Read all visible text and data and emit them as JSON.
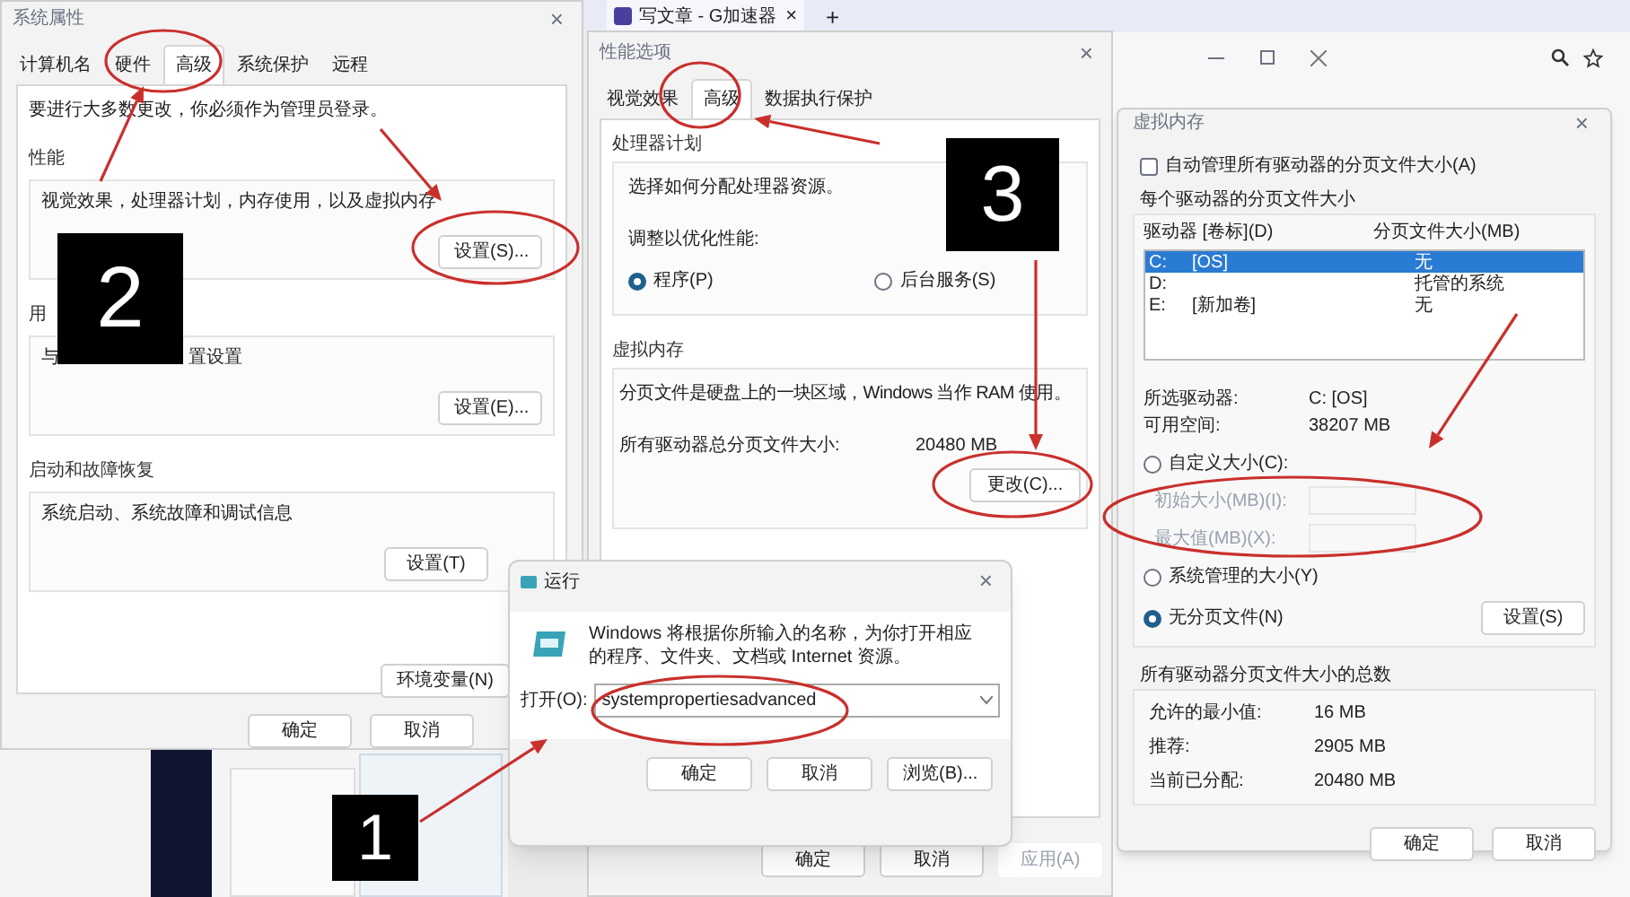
{
  "browser": {
    "tab": {
      "title": "写文章 - G加速器",
      "close": "×"
    },
    "new_tab": "+"
  },
  "system_properties": {
    "title": "系统属性",
    "close": "×",
    "tabs": [
      {
        "label": "计算机名",
        "selected": false
      },
      {
        "label": "硬件",
        "selected": false
      },
      {
        "label": "高级",
        "selected": true
      },
      {
        "label": "系统保护",
        "selected": false
      },
      {
        "label": "远程",
        "selected": false
      }
    ],
    "notice": "要进行大多数更改，你必须作为管理员登录。",
    "groups": [
      {
        "title": "性能",
        "description": [
          "视觉效果，处理器计划，内存使用，以及虚拟内存"
        ],
        "button": "设置(S)..."
      },
      {
        "title": "用",
        "description": [
          "与",
          "置设置"
        ],
        "button": "设置(E)..."
      },
      {
        "title": "启动和故障恢复",
        "description": [
          "系统启动、系统故障和调试信息"
        ],
        "button": "设置(T)"
      }
    ],
    "env_button": "环境变量(N)",
    "buttons": [
      "确定",
      "取消"
    ]
  },
  "performance_options": {
    "title": "性能选项",
    "close": "×",
    "tabs": [
      {
        "label": "视觉效果",
        "selected": false
      },
      {
        "label": "高级",
        "selected": true
      },
      {
        "label": "数据执行保护",
        "selected": false
      }
    ],
    "processor": {
      "title": "处理器计划",
      "description": "选择如何分配处理器资源。",
      "prompt": "调整以优化性能:",
      "options": [
        {
          "label": "程序(P)",
          "selected": true
        },
        {
          "label": "后台服务(S)",
          "selected": false
        }
      ]
    },
    "virtual_memory": {
      "title": "虚拟内存",
      "description": "分页文件是硬盘上的一块区域，Windows 当作 RAM 使用。",
      "total_label": "所有驱动器总分页文件大小:",
      "total_value": "20480 MB",
      "button": "更改(C)..."
    },
    "buttons": [
      {
        "label": "确定",
        "disabled": false
      },
      {
        "label": "取消",
        "disabled": false
      },
      {
        "label": "应用(A)",
        "disabled": true
      }
    ]
  },
  "virtual_memory": {
    "title": "虚拟内存",
    "close": "×",
    "auto_manage": {
      "label": "自动管理所有驱动器的分页文件大小(A)",
      "checked": false
    },
    "drives_title": "每个驱动器的分页文件大小",
    "columns": [
      "驱动器 [卷标](D)",
      "分页文件大小(MB)"
    ],
    "drives": [
      {
        "drive": "C:",
        "label": "[OS]",
        "size": "无",
        "selected": true
      },
      {
        "drive": "D:",
        "size": "托管的系统",
        "selected": false
      },
      {
        "drive": "E:",
        "label": "[新加卷]",
        "size": "无",
        "selected": false
      }
    ],
    "selected_drive": {
      "label": "所选驱动器:",
      "value": "C:  [OS]"
    },
    "free_space": {
      "label": "可用空间:",
      "value": "38207 MB"
    },
    "options": [
      {
        "kind": "radio",
        "label": "自定义大小(C):",
        "selected": false
      },
      {
        "kind": "field",
        "label": "初始大小(MB)(I):",
        "disabled": true
      },
      {
        "kind": "field",
        "label": "最大值(MB)(X):",
        "disabled": true
      },
      {
        "kind": "radio",
        "label": "系统管理的大小(Y)",
        "selected": false
      },
      {
        "kind": "radio",
        "label": "无分页文件(N)",
        "selected": true
      }
    ],
    "set_button": "设置(S)",
    "totals_title": "所有驱动器分页文件大小的总数",
    "totals": [
      {
        "label": "允许的最小值:",
        "value": "16 MB"
      },
      {
        "label": "推荐:",
        "value": "2905 MB"
      },
      {
        "label": "当前已分配:",
        "value": "20480 MB"
      }
    ],
    "buttons": [
      "确定",
      "取消"
    ]
  },
  "run_dialog": {
    "title": "运行",
    "close": "×",
    "description": "Windows 将根据你所输入的名称，为你打开相应的程序、文件夹、文档或 Internet 资源。",
    "open_label": "打开(O):",
    "value": "systempropertiesadvanced",
    "buttons": [
      "确定",
      "取消",
      "浏览(B)..."
    ]
  },
  "step_badges": [
    "2",
    "3",
    "1"
  ]
}
